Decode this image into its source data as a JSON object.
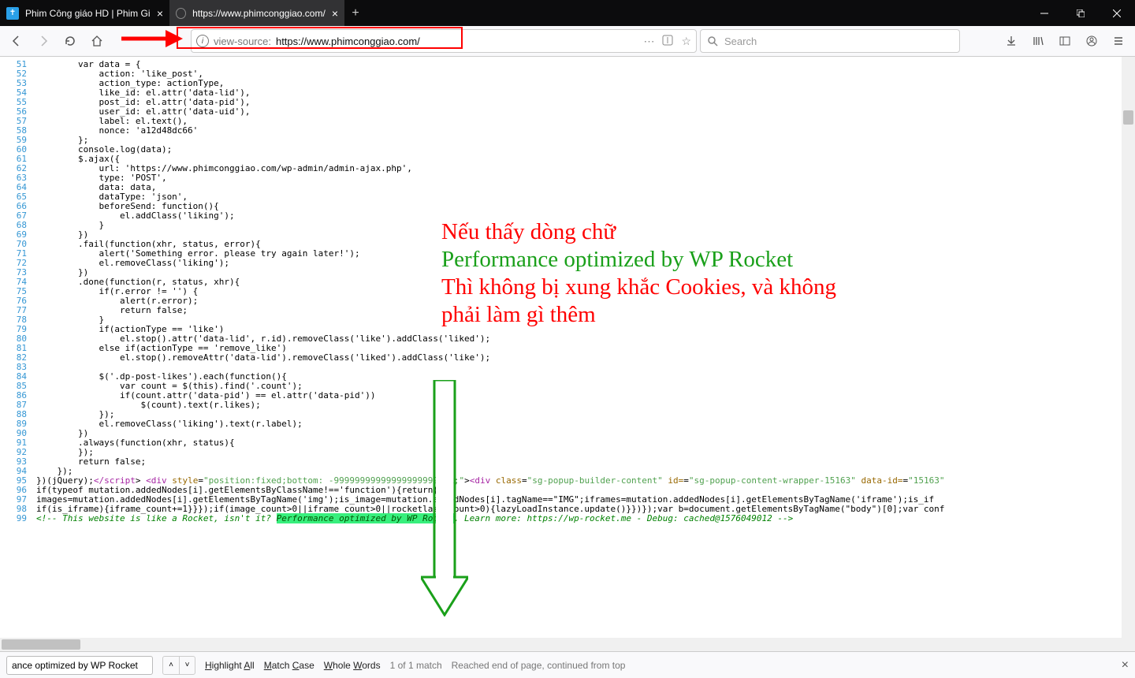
{
  "titlebar": {
    "tabs": [
      {
        "title": "Phim Công giáo HD | Phim Gi"
      },
      {
        "title": "https://www.phimconggiao.com/"
      }
    ],
    "newtab": "+"
  },
  "navbar": {
    "url_pre": "view-source:",
    "url_main": "https://www.phimconggiao.com/",
    "search_placeholder": "Search"
  },
  "annotations": {
    "line1": "Nếu thấy dòng chữ",
    "line2": "Performance optimized by WP Rocket",
    "line3": "Thì không bị xung khắc Cookies, và không",
    "line4": "phải làm gì thêm"
  },
  "source": {
    "start": 51,
    "lines": [
      "        var data = {",
      "            action: 'like_post',",
      "            action_type: actionType,",
      "            like_id: el.attr('data-lid'),",
      "            post_id: el.attr('data-pid'),",
      "            user_id: el.attr('data-uid'),",
      "            label: el.text(),",
      "            nonce: 'a12d48dc66'",
      "        };",
      "        console.log(data);",
      "        $.ajax({",
      "            url: 'https://www.phimconggiao.com/wp-admin/admin-ajax.php',",
      "            type: 'POST',",
      "            data: data,",
      "            dataType: 'json',",
      "            beforeSend: function(){",
      "                el.addClass('liking');",
      "            }",
      "        })",
      "        .fail(function(xhr, status, error){",
      "            alert('Something error. please try again later!');",
      "            el.removeClass('liking');",
      "        })",
      "        .done(function(r, status, xhr){",
      "            if(r.error != '') {",
      "                alert(r.error);",
      "                return false;",
      "            }",
      "            if(actionType == 'like')",
      "                el.stop().attr('data-lid', r.id).removeClass('like').addClass('liked');",
      "            else if(actionType == 'remove_like')",
      "                el.stop().removeAttr('data-lid').removeClass('liked').addClass('like');",
      "",
      "            $('.dp-post-likes').each(function(){",
      "                var count = $(this).find('.count');",
      "                if(count.attr('data-pid') == el.attr('data-pid'))",
      "                    $(count).text(r.likes);",
      "            });",
      "            el.removeClass('liking').text(r.label);",
      "        })",
      "        .always(function(xhr, status){",
      "        });",
      "        return false;",
      "    });"
    ],
    "tail95": {
      "pre": "})(jQuery);",
      "close": "</script",
      "gt": ">",
      "div": " <div ",
      "sty": "style=",
      "styv": "\"position:fixed;bottom: -999999999999999999999px;\"",
      "mid": "><div ",
      "cls": "class=",
      "clsv": "\"sg-popup-builder-content\"",
      "idk": " id=",
      "idv": "\"sg-popup-content-wrapper-15163\"",
      "dk": " data-id=",
      "dv": "\"15163\""
    },
    "tail96": "if(typeof mutation.addedNodes[i].getElementsByClassName!=='function'){return}",
    "tail97": "images=mutation.addedNodes[i].getElementsByTagName('img');is_image=mutation.addedNodes[i].tagName==\"IMG\";iframes=mutation.addedNodes[i].getElementsByTagName('iframe');is_if",
    "tail98": "if(is_iframe){iframe_count+=1}}});if(image_count>0||iframe_count>0||rocketlazy_count>0){lazyLoadInstance.update()}})});var b=document.getElementsByTagName(\"body\")[0];var conf",
    "tail99_a": "<!-- This website is like a Rocket, isn't it? ",
    "tail99_hl": "Performance optimized by WP Rocket",
    "tail99_b": ". Learn more: https://wp-rocket.me - Debug: cached@1576049012 -->"
  },
  "findbar": {
    "value": "ance optimized by WP Rocket",
    "highlight": "Highlight All",
    "matchcase": "Match Case",
    "whole": "Whole Words",
    "count": "1 of 1 match",
    "status": "Reached end of page, continued from top"
  }
}
